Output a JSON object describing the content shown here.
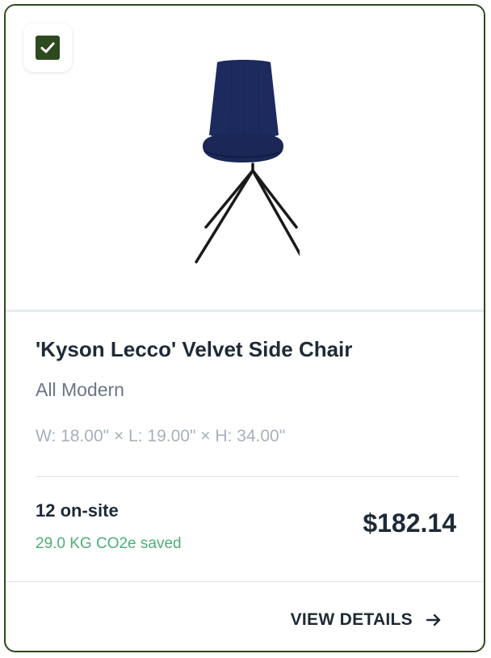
{
  "product": {
    "title": "'Kyson Lecco' Velvet Side Chair",
    "brand": "All Modern",
    "dimensions": "W: 18.00\" × L: 19.00\" × H: 34.00\"",
    "onsite": "12 on-site",
    "co2_saved": "29.0 KG CO2e saved",
    "price": "$182.14",
    "selected": true,
    "image_icon": "chair-image",
    "chair_color": "#1c2a5e"
  },
  "actions": {
    "view_details_label": "VIEW DETAILS",
    "view_details_icon": "arrow-right-icon"
  },
  "colors": {
    "accent": "#2d4a1e",
    "co2_green": "#4cae79",
    "text_dark": "#1e2a36"
  }
}
